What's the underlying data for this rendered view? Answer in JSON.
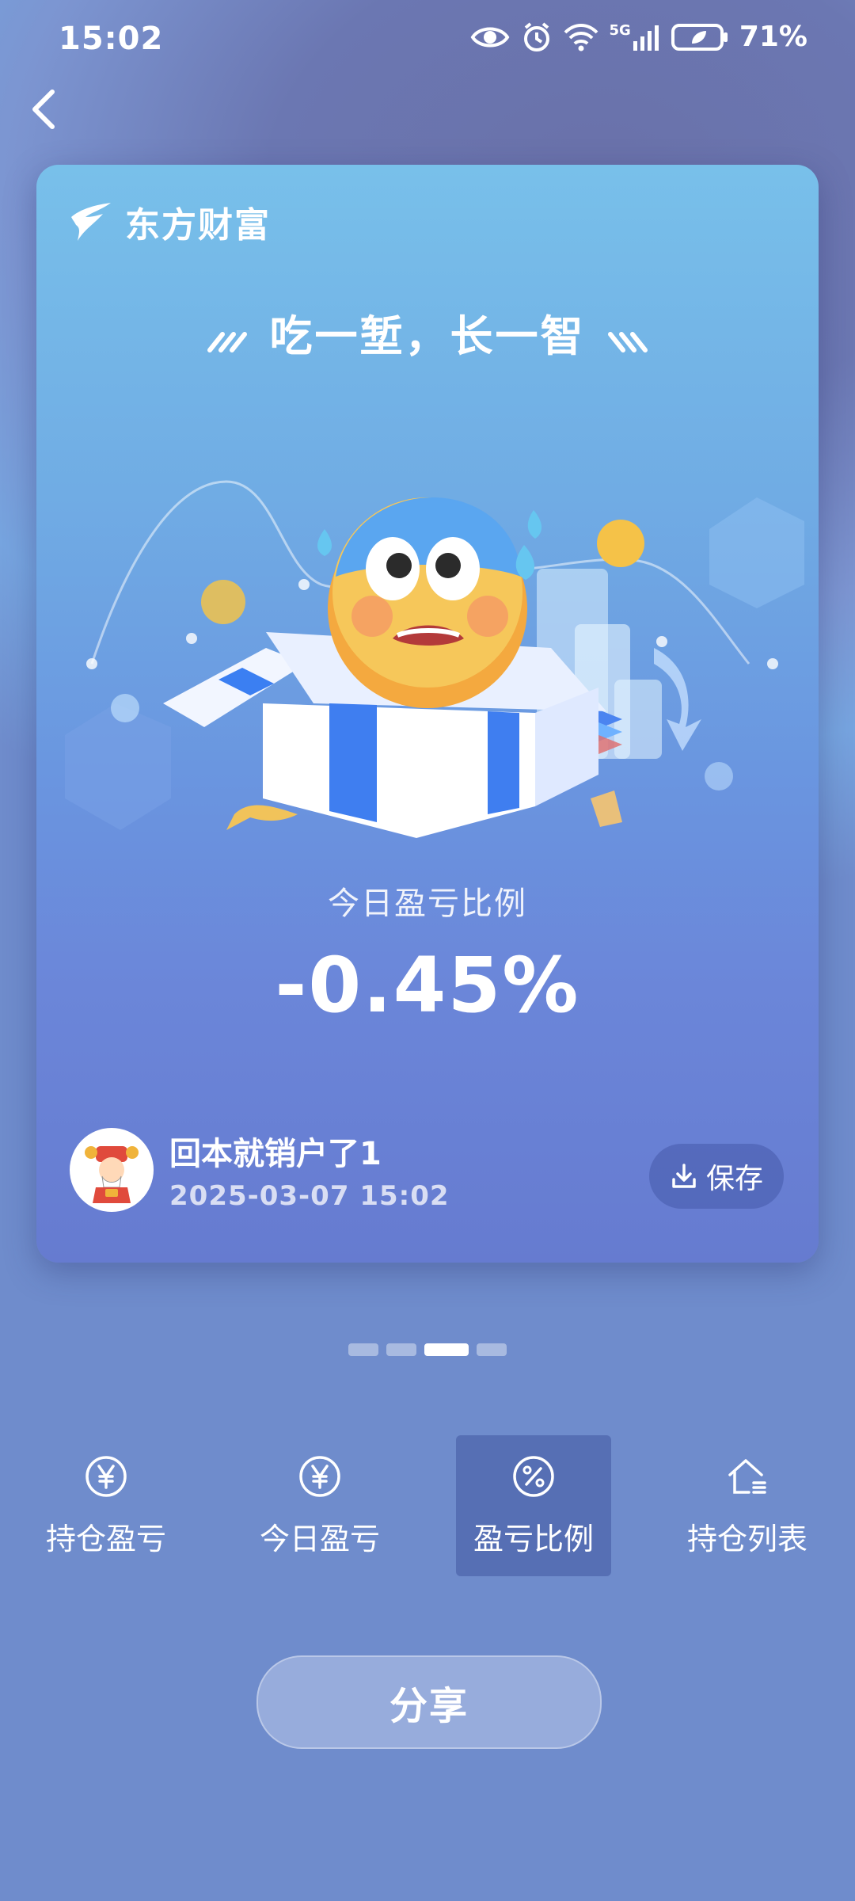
{
  "status": {
    "time": "15:02",
    "network": "5G",
    "battery": "71%"
  },
  "card": {
    "brand": "东方财富",
    "slogan": "吃一堑，长一智",
    "metric_label": "今日盈亏比例",
    "metric_value": "-0.45%",
    "user_name": "回本就销户了1",
    "timestamp": "2025-03-07 15:02",
    "save_label": "保存"
  },
  "tabs": [
    {
      "label": "持仓盈亏",
      "icon": "yen-circle-icon"
    },
    {
      "label": "今日盈亏",
      "icon": "yen-circle-icon"
    },
    {
      "label": "盈亏比例",
      "icon": "percent-circle-icon"
    },
    {
      "label": "持仓列表",
      "icon": "house-list-icon"
    }
  ],
  "share_label": "分享",
  "carousel": {
    "pages": 4,
    "active_index": 2
  }
}
